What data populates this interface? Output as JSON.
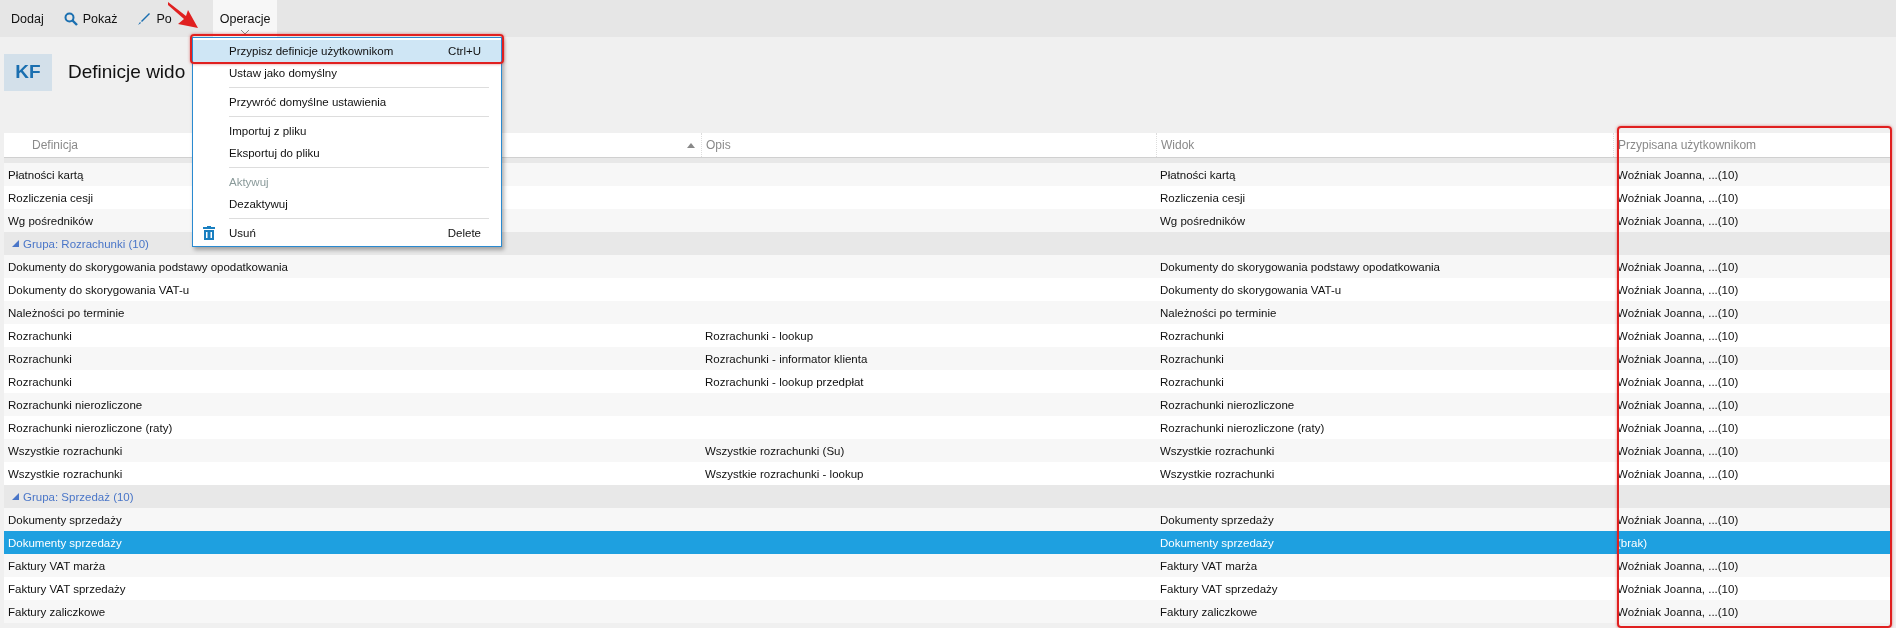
{
  "toolbar": {
    "buttons": [
      {
        "label": "Dodaj",
        "kind": "text"
      },
      {
        "label": "Pokaż",
        "kind": "search"
      },
      {
        "label": "Po",
        "kind": "pen"
      },
      {
        "label": "Operacje",
        "kind": "menu",
        "selected": true
      }
    ]
  },
  "header": {
    "badge": "KF",
    "title": "Definicje wido"
  },
  "menu": {
    "groups": [
      [
        {
          "label": "Przypisz definicje użytkownikom",
          "shortcut": "Ctrl+U",
          "selected": true,
          "disabled": false,
          "kind": "plain"
        },
        {
          "label": "Ustaw jako domyślny",
          "selected": false,
          "disabled": false,
          "kind": "plain"
        }
      ],
      [
        {
          "label": "Przywróć domyślne ustawienia",
          "selected": false,
          "disabled": false,
          "kind": "plain"
        }
      ],
      [
        {
          "label": "Importuj z pliku",
          "selected": false,
          "disabled": false,
          "kind": "plain"
        },
        {
          "label": "Eksportuj do pliku",
          "selected": false,
          "disabled": false,
          "kind": "plain"
        }
      ],
      [
        {
          "label": "Aktywuj",
          "selected": false,
          "disabled": true,
          "kind": "plain"
        },
        {
          "label": "Dezaktywuj",
          "selected": false,
          "disabled": false,
          "kind": "plain"
        }
      ],
      [
        {
          "label": "Usuń",
          "shortcut": "Delete",
          "selected": false,
          "disabled": false,
          "kind": "trash"
        }
      ]
    ]
  },
  "table": {
    "columns": [
      {
        "label": "Definicja",
        "sorted": true
      },
      {
        "label": "Opis",
        "sorted": false
      },
      {
        "label": "Widok",
        "sorted": false
      },
      {
        "label": "Przypisana użytkownikom",
        "sorted": false
      }
    ],
    "rows": [
      {
        "kind": "row",
        "selected": false,
        "cells": [
          "Płatności kartą",
          "",
          "Płatności kartą",
          "Woźniak Joanna, ...(10)"
        ]
      },
      {
        "kind": "row",
        "selected": false,
        "cells": [
          "Rozliczenia cesji",
          "",
          "Rozliczenia cesji",
          "Woźniak Joanna, ...(10)"
        ]
      },
      {
        "kind": "row",
        "selected": false,
        "cells": [
          "Wg pośredników",
          "",
          "Wg pośredników",
          "Woźniak Joanna, ...(10)"
        ]
      },
      {
        "kind": "group",
        "expanded": true,
        "label": "Grupa: Rozrachunki (10)"
      },
      {
        "kind": "row",
        "selected": false,
        "cells": [
          "Dokumenty do skorygowania podstawy opodatkowania",
          "",
          "Dokumenty do skorygowania podstawy opodatkowania",
          "Woźniak Joanna, ...(10)"
        ]
      },
      {
        "kind": "row",
        "selected": false,
        "cells": [
          "Dokumenty do skorygowania VAT-u",
          "",
          "Dokumenty do skorygowania VAT-u",
          "Woźniak Joanna, ...(10)"
        ]
      },
      {
        "kind": "row",
        "selected": false,
        "cells": [
          "Należności po terminie",
          "",
          "Należności po terminie",
          "Woźniak Joanna, ...(10)"
        ]
      },
      {
        "kind": "row",
        "selected": false,
        "cells": [
          "Rozrachunki",
          "Rozrachunki - lookup",
          "Rozrachunki",
          "Woźniak Joanna, ...(10)"
        ]
      },
      {
        "kind": "row",
        "selected": false,
        "cells": [
          "Rozrachunki",
          "Rozrachunki - informator klienta",
          "Rozrachunki",
          "Woźniak Joanna, ...(10)"
        ]
      },
      {
        "kind": "row",
        "selected": false,
        "cells": [
          "Rozrachunki",
          "Rozrachunki - lookup przedpłat",
          "Rozrachunki",
          "Woźniak Joanna, ...(10)"
        ]
      },
      {
        "kind": "row",
        "selected": false,
        "cells": [
          "Rozrachunki nierozliczone",
          "",
          "Rozrachunki nierozliczone",
          "Woźniak Joanna, ...(10)"
        ]
      },
      {
        "kind": "row",
        "selected": false,
        "cells": [
          "Rozrachunki nierozliczone (raty)",
          "",
          "Rozrachunki nierozliczone (raty)",
          "Woźniak Joanna, ...(10)"
        ]
      },
      {
        "kind": "row",
        "selected": false,
        "cells": [
          "Wszystkie rozrachunki",
          "Wszystkie rozrachunki (Su)",
          "Wszystkie rozrachunki",
          "Woźniak Joanna, ...(10)"
        ]
      },
      {
        "kind": "row",
        "selected": false,
        "cells": [
          "Wszystkie rozrachunki",
          "Wszystkie rozrachunki - lookup",
          "Wszystkie rozrachunki",
          "Woźniak Joanna, ...(10)"
        ]
      },
      {
        "kind": "group",
        "expanded": true,
        "label": "Grupa: Sprzedaż (10)"
      },
      {
        "kind": "row",
        "selected": false,
        "cells": [
          "Dokumenty sprzedaży",
          "",
          "Dokumenty sprzedaży",
          "Woźniak Joanna, ...(10)"
        ]
      },
      {
        "kind": "row",
        "selected": true,
        "cells": [
          "Dokumenty sprzedaży",
          "",
          "Dokumenty sprzedaży",
          "(brak)"
        ]
      },
      {
        "kind": "row",
        "selected": false,
        "cells": [
          "Faktury VAT marża",
          "",
          "Faktury VAT marża",
          "Woźniak Joanna, ...(10)"
        ]
      },
      {
        "kind": "row",
        "selected": false,
        "cells": [
          "Faktury VAT sprzedaży",
          "",
          "Faktury VAT sprzedaży",
          "Woźniak Joanna, ...(10)"
        ]
      },
      {
        "kind": "row",
        "selected": false,
        "cells": [
          "Faktury zaliczkowe",
          "",
          "Faktury zaliczkowe",
          "Woźniak Joanna, ...(10)"
        ]
      }
    ]
  }
}
